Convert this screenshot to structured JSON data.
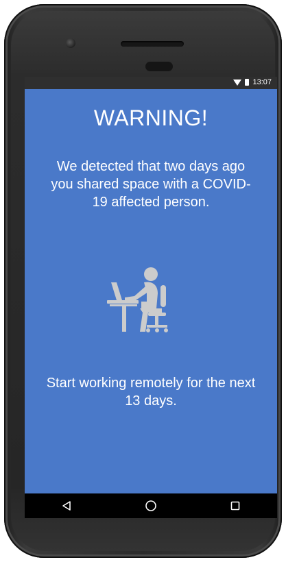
{
  "status_bar": {
    "time": "13:07",
    "icons": [
      "wifi-icon",
      "battery-icon"
    ]
  },
  "alert": {
    "title": "WARNING!",
    "message": "We detected that two days ago you shared space with a COVID-19 affected person.",
    "illustration": "person-working-at-desk-icon",
    "advice": "Start working remotely for the next 13 days."
  },
  "navigation": {
    "buttons": [
      "back-icon",
      "home-icon",
      "recents-icon"
    ]
  },
  "colors": {
    "background": "#4a79c9",
    "text": "#ffffff",
    "illustration": "#cccccc"
  }
}
